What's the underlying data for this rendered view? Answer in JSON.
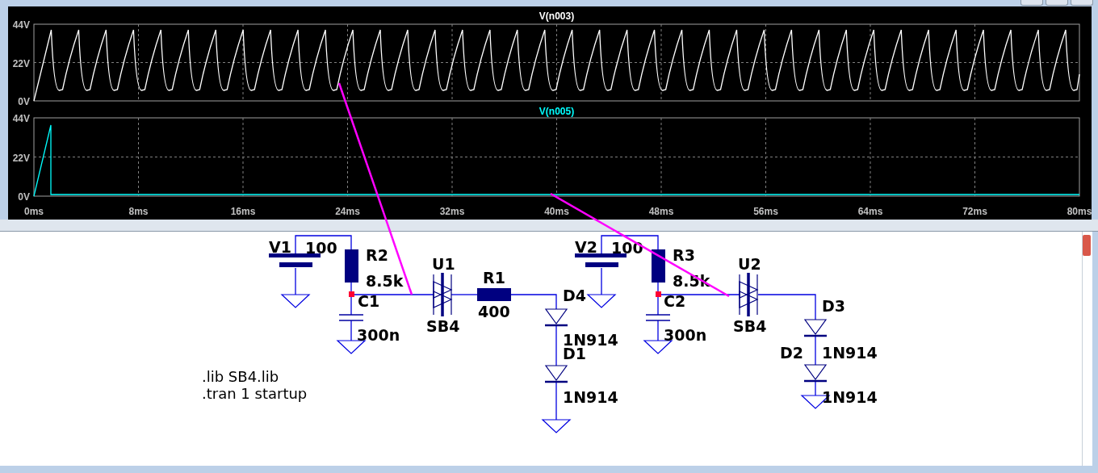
{
  "plot_window": {
    "plots": [
      {
        "trace": "V(n003)",
        "color": "#ffffff",
        "y_ticks": [
          "44V",
          "22V",
          "0V"
        ]
      },
      {
        "trace": "V(n005)",
        "color": "#00ffff",
        "y_ticks": [
          "44V",
          "22V",
          "0V"
        ]
      }
    ],
    "x_ticks": [
      "0ms",
      "8ms",
      "16ms",
      "24ms",
      "32ms",
      "40ms",
      "48ms",
      "56ms",
      "64ms",
      "72ms",
      "80ms"
    ]
  },
  "schematic": {
    "components": [
      {
        "kind": "voltage_source",
        "name": "V1",
        "value": "100"
      },
      {
        "kind": "voltage_source",
        "name": "V2",
        "value": "100"
      },
      {
        "kind": "resistor",
        "name": "R2",
        "value": "8.5k"
      },
      {
        "kind": "resistor",
        "name": "R3",
        "value": "8.5k"
      },
      {
        "kind": "sidac",
        "name": "U1",
        "value": "SB4"
      },
      {
        "kind": "resistor",
        "name": "R1",
        "value": "400"
      },
      {
        "kind": "sidac",
        "name": "U2",
        "value": "SB4"
      },
      {
        "kind": "capacitor",
        "name": "C1",
        "value": "300n"
      },
      {
        "kind": "diode",
        "name": "D4",
        "value": "1N914"
      },
      {
        "kind": "capacitor",
        "name": "C2",
        "value": "300n"
      },
      {
        "kind": "diode",
        "name": "D3",
        "value": "1N914"
      },
      {
        "kind": "diode",
        "name": "D1",
        "value": "1N914"
      },
      {
        "kind": "diode",
        "name": "D2",
        "value": "1N914"
      }
    ],
    "directives": [
      ".lib SB4.lib",
      ".tran 1 startup"
    ]
  }
}
